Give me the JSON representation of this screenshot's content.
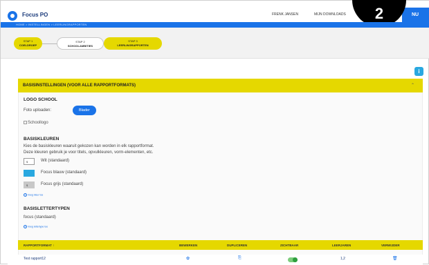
{
  "app": {
    "title": "Focus PO"
  },
  "header": {
    "user": "FRENK JANSEN",
    "downloads": "MIJN DOWNLOADS",
    "menu_label": "NU",
    "step_badge": "2"
  },
  "breadcrumb": "HOME  >  INSTELLINGEN  >  LEERLINGRAPPORTEN",
  "steps": [
    {
      "num": "STAP 1",
      "label": "COELDROEP"
    },
    {
      "num": "STAP 2",
      "label": "SCHOOLAMBITIES"
    },
    {
      "num": "STAP 3",
      "label": "LEERLINGRAPPORTEN"
    }
  ],
  "info_icon_label": "i",
  "section": {
    "title": "BASISINSTELLINGEN (VOOR ALLE RAPPORTFORMATS)",
    "logo": {
      "heading": "LOGO SCHOOL",
      "upload_label": "Foto uploaden:",
      "browse_label": "Blader",
      "img_alt": "Schoollogo"
    },
    "colors": {
      "heading": "BASISKLEUREN",
      "desc1": "Kies de basiskleuren waaruit gekozen kan worden in elk rapportformat.",
      "desc2": "Deze kleuren gebruik je voor titels, opvulkleuren, vorm-elementen, etc.",
      "items": [
        {
          "swatch_text": "$",
          "label": "Wit (standaard)",
          "color": "#ffffff"
        },
        {
          "swatch_text": "",
          "label": "Focus blauw (standaard)",
          "color": "#29a8e0"
        },
        {
          "swatch_text": "$",
          "label": "Focus grijs (standaard)",
          "color": "#c8c8c8"
        }
      ],
      "add_link": "Voeg kleur toe"
    },
    "fonts": {
      "heading": "BASISLETTERTYPEN",
      "value": "focus (standaard)",
      "add_link": "Voeg lettertype toe"
    }
  },
  "table": {
    "headers": [
      "RAPPORTFORMAT",
      "BEWERKEN",
      "DUPLICEREN",
      "ZICHTBAAR",
      "LEERJAREN",
      "VERWIJDER"
    ],
    "sort_icon": "↑",
    "rows": [
      {
        "name": "Test rapport12",
        "edit_icon": "✿",
        "dup_icon": "⎘",
        "leerjaren": "1,2",
        "delete_icon": "🗑"
      }
    ]
  },
  "colors": {
    "accent": "#1a73e8",
    "yellow": "#e5d800",
    "toggle_on": "#2e9e3e"
  }
}
